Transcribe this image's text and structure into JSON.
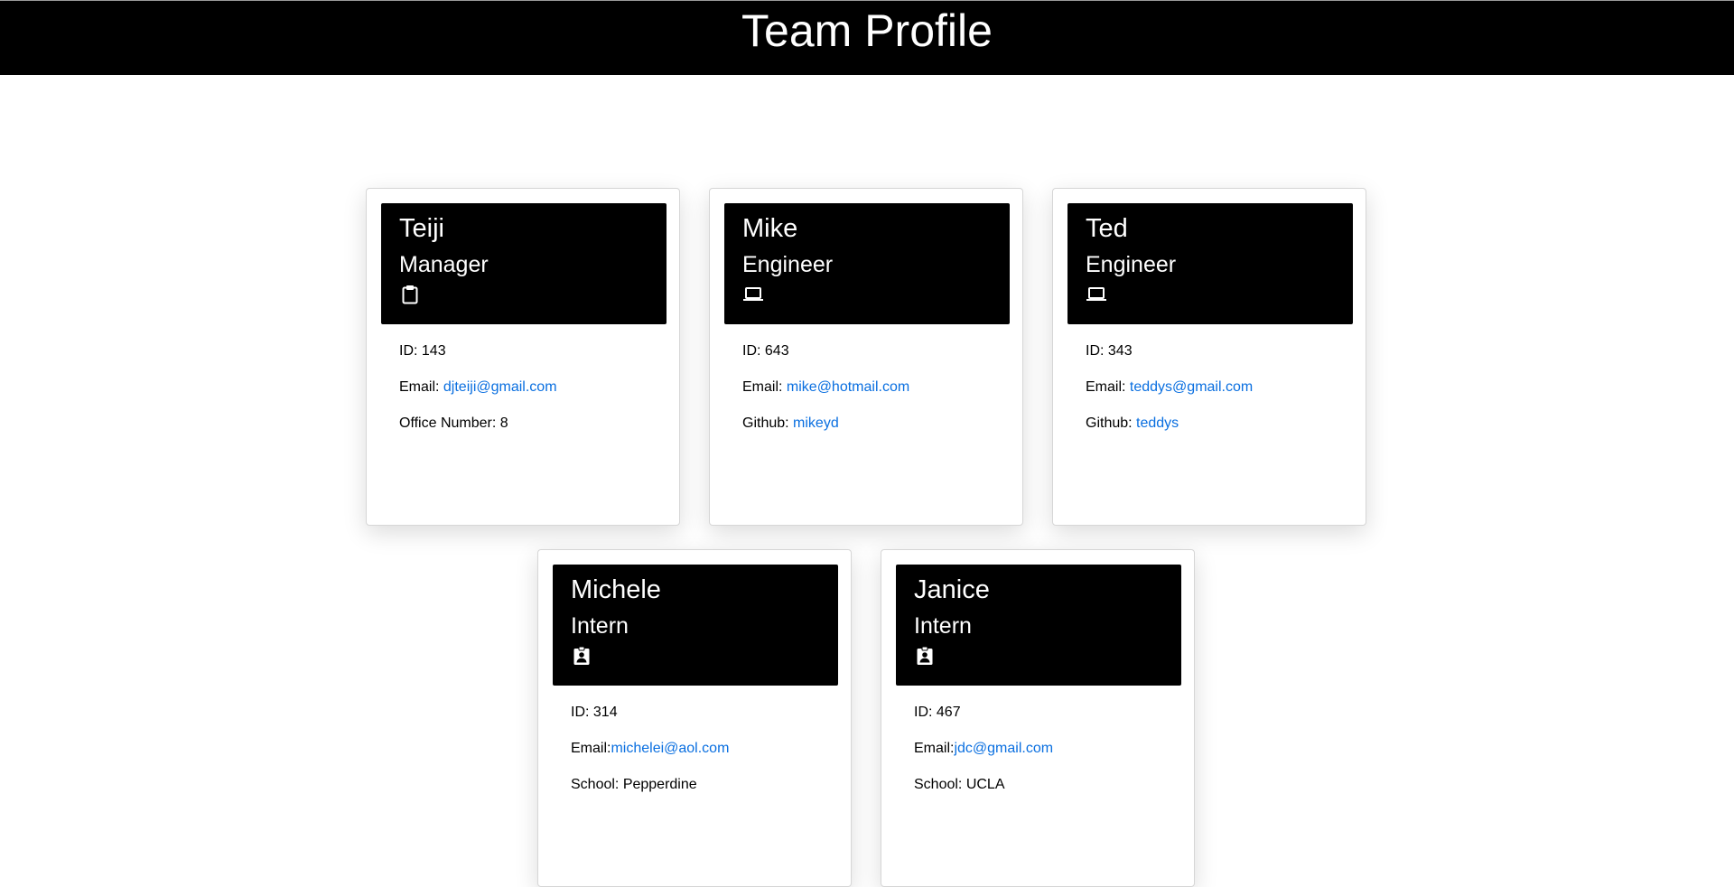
{
  "page": {
    "title": "Team Profile"
  },
  "icons": {
    "Manager": "clipboard-icon",
    "Engineer": "laptop-icon",
    "Intern": "id-badge-icon"
  },
  "colors": {
    "header_bg": "#000000",
    "header_text": "#ffffff",
    "link": "#0a6fe0"
  },
  "team": [
    {
      "name": "Teiji",
      "role": "Manager",
      "icon": "clipboard-icon",
      "id_label": "ID: 143",
      "email_label": "Email: ",
      "email": "djteiji@gmail.com",
      "extra_label": "Office Number: 8",
      "extra_link": ""
    },
    {
      "name": "Mike",
      "role": "Engineer",
      "icon": "laptop-icon",
      "id_label": "ID: 643",
      "email_label": "Email: ",
      "email": "mike@hotmail.com",
      "extra_label": "Github: ",
      "extra_link": "mikeyd"
    },
    {
      "name": "Ted",
      "role": "Engineer",
      "icon": "laptop-icon",
      "id_label": "ID: 343",
      "email_label": "Email: ",
      "email": "teddys@gmail.com",
      "extra_label": "Github: ",
      "extra_link": "teddys"
    },
    {
      "name": "Michele",
      "role": "Intern",
      "icon": "id-badge-icon",
      "id_label": "ID: 314",
      "email_label": "Email:",
      "email": "michelei@aol.com",
      "extra_label": "School: Pepperdine",
      "extra_link": ""
    },
    {
      "name": "Janice",
      "role": "Intern",
      "icon": "id-badge-icon",
      "id_label": "ID: 467",
      "email_label": "Email:",
      "email": "jdc@gmail.com",
      "extra_label": "School: UCLA",
      "extra_link": ""
    }
  ]
}
